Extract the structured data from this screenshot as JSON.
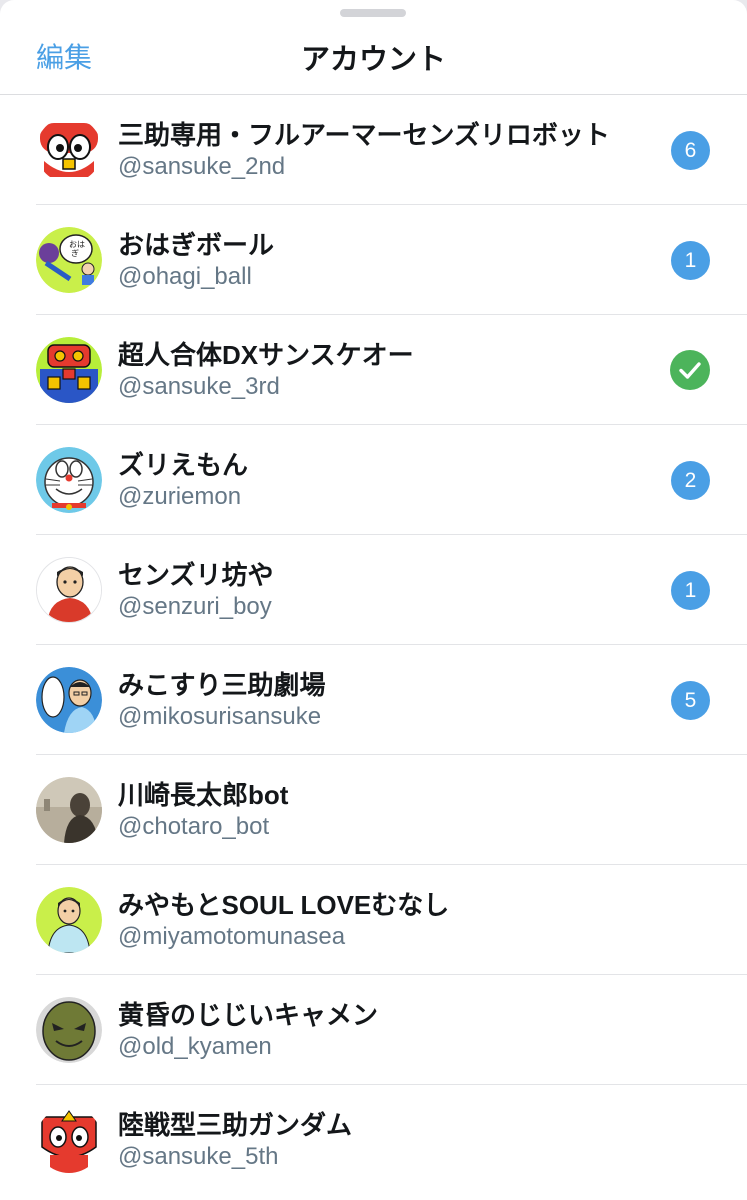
{
  "header": {
    "edit_label": "編集",
    "title": "アカウント"
  },
  "colors": {
    "accent_blue": "#4a9fe5",
    "check_green": "#4cb45b"
  },
  "accounts": [
    {
      "name": "三助専用・フルアーマーセンズリロボット",
      "handle": "@sansuke_2nd",
      "badge": "6"
    },
    {
      "name": "おはぎボール",
      "handle": "@ohagi_ball",
      "badge": "1"
    },
    {
      "name": "超人合体DXサンスケオー",
      "handle": "@sansuke_3rd",
      "badge": "",
      "current": true
    },
    {
      "name": "ズリえもん",
      "handle": "@zuriemon",
      "badge": "2"
    },
    {
      "name": "センズリ坊や",
      "handle": "@senzuri_boy",
      "badge": "1"
    },
    {
      "name": "みこすり三助劇場",
      "handle": "@mikosurisansuke",
      "badge": "5"
    },
    {
      "name": "川崎長太郎bot",
      "handle": "@chotaro_bot",
      "badge": ""
    },
    {
      "name": "みやもとSOUL LOVEむなし",
      "handle": "@miyamotomunasea",
      "badge": ""
    },
    {
      "name": "黄昏のじじいキャメン",
      "handle": "@old_kyamen",
      "badge": ""
    },
    {
      "name": "陸戦型三助ガンダム",
      "handle": "@sansuke_5th",
      "badge": ""
    }
  ]
}
